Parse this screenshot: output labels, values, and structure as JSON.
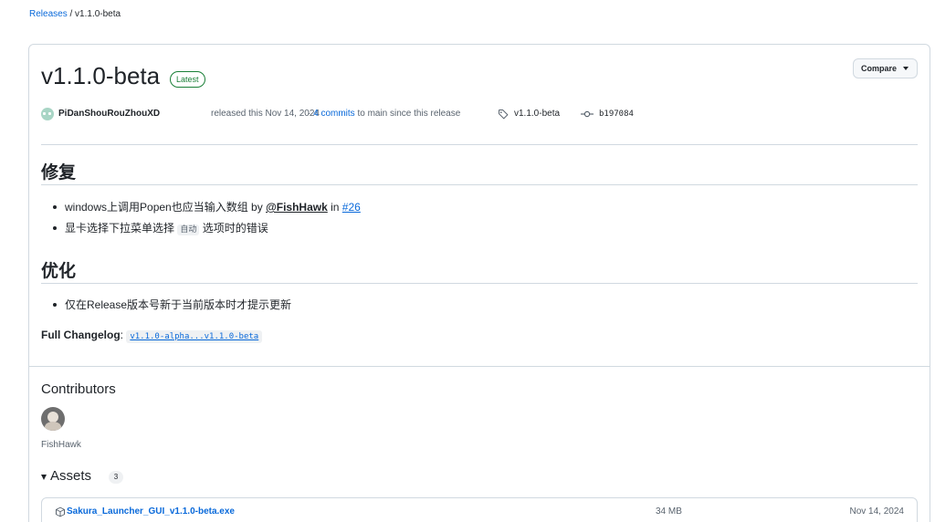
{
  "breadcrumb": {
    "link": "Releases",
    "separator": " / ",
    "current": "v1.1.0-beta"
  },
  "release": {
    "title": "v1.1.0-beta",
    "badge": "Latest",
    "compare_label": "Compare",
    "author": "PiDanShouRouZhouXD",
    "released_text": "released this Nov 14, 2024",
    "commits_prefix": "· ",
    "commits_link": "4 commits",
    "commits_suffix": " to main since this release",
    "tag": "v1.1.0-beta",
    "sha": "b197084"
  },
  "body": {
    "section1_heading": "修复",
    "section1_items": [
      {
        "text": "windows上调用Popen也应当输入数组 by ",
        "user": "@FishHawk",
        "mid": " in ",
        "issue": "#26"
      },
      {
        "prefix": "显卡选择下拉菜单选择 ",
        "code": "自动",
        "suffix": " 选项时的错误"
      }
    ],
    "section2_heading": "优化",
    "section2_items": [
      {
        "text": "仅在Release版本号新于当前版本时才提示更新"
      }
    ],
    "changelog_label": "Full Changelog",
    "changelog_colon": ": ",
    "changelog_link": "v1.1.0-alpha...v1.1.0-beta"
  },
  "contributors": {
    "title": "Contributors",
    "names": [
      "FishHawk"
    ]
  },
  "assets": {
    "title": "Assets",
    "count": "3",
    "items": [
      {
        "name": "Sakura_Launcher_GUI_v1.1.0-beta.exe",
        "size": "34 MB",
        "date": "Nov 14, 2024"
      }
    ]
  },
  "colors": {
    "accent": "#0969da",
    "latest": "#1a7f37",
    "border": "#d1d9e0",
    "text": "#1f2328",
    "muted": "#59636e"
  }
}
